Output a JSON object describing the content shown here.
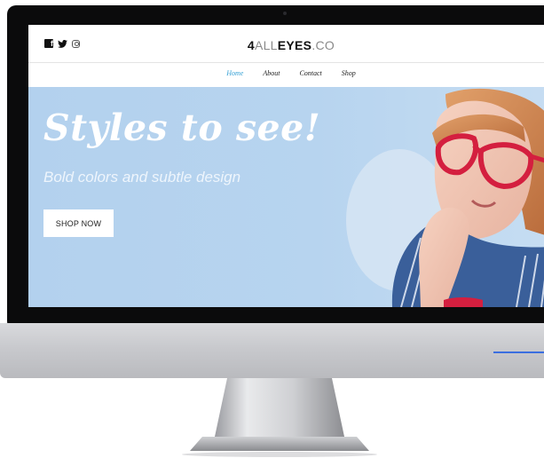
{
  "site": {
    "social_icons": [
      "facebook-icon",
      "twitter-icon",
      "instagram-icon"
    ],
    "logo": {
      "prefix": "4",
      "middle": "ALL",
      "emphasis": "EYES",
      "suffix": ".CO"
    },
    "nav": {
      "items": [
        {
          "label": "Home",
          "active": true
        },
        {
          "label": "About",
          "active": false
        },
        {
          "label": "Contact",
          "active": false
        },
        {
          "label": "Shop",
          "active": false
        }
      ]
    },
    "hero": {
      "headline": "Styles to see!",
      "subline": "Bold colors and subtle design",
      "cta_label": "SHOP NOW"
    }
  },
  "colors": {
    "hero_bg": "#b5d2ee",
    "nav_active": "#3aa3d6",
    "glasses": "#d41f3f",
    "accent_line": "#3b6fe0"
  }
}
